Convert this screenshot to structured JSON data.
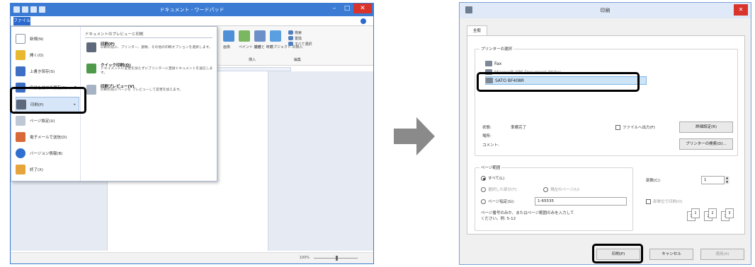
{
  "wordpad": {
    "title": "ドキュメント - ワードパッド",
    "file_tab": "ファイル",
    "file_menu": {
      "items": [
        {
          "label": "新規(N)",
          "icon": "new-document-icon",
          "color": "#ffffff"
        },
        {
          "label": "開く(O)",
          "icon": "open-folder-icon",
          "color": "#e8b830"
        },
        {
          "label": "上書き保存(S)",
          "icon": "save-icon",
          "color": "#3f6fc4"
        },
        {
          "label": "名前を付けて保存(A)",
          "icon": "save-as-icon",
          "color": "#3f6fc4"
        },
        {
          "label": "印刷(P)",
          "icon": "printer-icon",
          "color": "#5e6a7c"
        },
        {
          "label": "ページ設定(U)",
          "icon": "page-setup-icon",
          "color": "#bfc9d6"
        },
        {
          "label": "電子メールで送信(D)",
          "icon": "email-icon",
          "color": "#d86a3a"
        },
        {
          "label": "バージョン情報(B)",
          "icon": "info-icon",
          "color": "#2f6fd0"
        },
        {
          "label": "終了(X)",
          "icon": "exit-icon",
          "color": "#e6a53a"
        }
      ],
      "right_header": "ドキュメントのプレビューと印刷",
      "options": [
        {
          "title": "印刷(P)",
          "desc": "印刷の前に、プリンター、部数、その他の印刷オプションを選択します。"
        },
        {
          "title": "クイック印刷(Q)",
          "desc": "ドキュメントに変更を加えずにプリンターに直接ドキュメントを送信します。"
        },
        {
          "title": "印刷プレビュー(V)",
          "desc": "印刷の前にページを プレビューして変更を加えます。"
        }
      ]
    },
    "ribbon_labels": [
      "画像",
      "ペイント\n描画",
      "日付と\n時刻",
      "オブジェクト\nの挿入",
      "検索",
      "置換",
      "すべて選択",
      "挿入",
      "編集"
    ],
    "zoom": "100%"
  },
  "dialog": {
    "title": "印刷",
    "tab": "全般",
    "printer_group_label": "プリンターの選択",
    "printers": [
      "Fax",
      "Microsoft XPS Document Writer",
      "SATO BF408R"
    ],
    "status_label": "状態:",
    "status_value": "準備完了",
    "location_label": "場所:",
    "comment_label": "コメント:",
    "print_to_file": "ファイルへ出力(F)",
    "preferences_button": "詳細設定(R)",
    "find_printer_button": "プリンターの検索(D)...",
    "page_range_label": "ページ範囲",
    "range_all": "すべて(L)",
    "range_selection": "選択した部分(T)",
    "range_current": "現在のページ(U)",
    "range_pages": "ページ指定(G):",
    "pages_value": "1-65535",
    "pages_hint": "ページ番号のみか、またはページ範囲のみを入力して\nください。例: 5-12",
    "copies_label": "部数(C):",
    "copies_value": "1",
    "collate_label": "部単位で印刷(O)",
    "collate_numbers": [
      "1",
      "1",
      "2",
      "2",
      "3",
      "3"
    ],
    "print_button": "印刷(P)",
    "cancel_button": "キャンセル",
    "apply_button": "適用(A)"
  }
}
